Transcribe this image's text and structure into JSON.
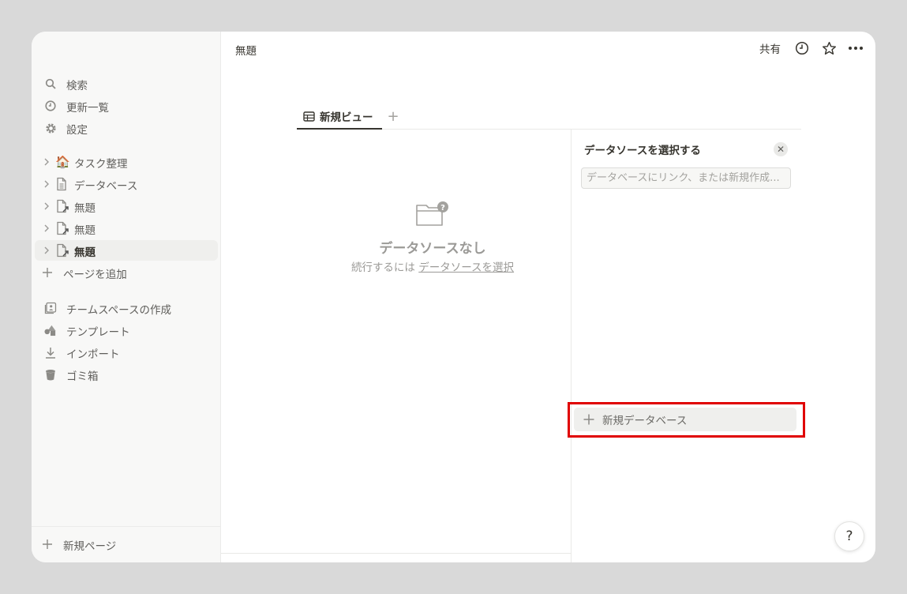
{
  "sidebar": {
    "top_items": [
      {
        "label": "検索",
        "icon": "search-icon"
      },
      {
        "label": "更新一覧",
        "icon": "clock-icon"
      },
      {
        "label": "設定",
        "icon": "gear-icon"
      }
    ],
    "pages": [
      {
        "label": "タスク整理",
        "icon": "house-emoji-icon",
        "emoji": "🏠"
      },
      {
        "label": "データベース",
        "icon": "page-icon"
      },
      {
        "label": "無題",
        "icon": "linked-page-icon"
      },
      {
        "label": "無題",
        "icon": "linked-page-icon"
      },
      {
        "label": "無題",
        "icon": "linked-page-icon",
        "active": true
      }
    ],
    "add_page_label": "ページを追加",
    "bottom_items": [
      {
        "label": "チームスペースの作成",
        "icon": "teamspace-icon"
      },
      {
        "label": "テンプレート",
        "icon": "shapes-icon"
      },
      {
        "label": "インポート",
        "icon": "download-icon"
      },
      {
        "label": "ゴミ箱",
        "icon": "trash-icon"
      }
    ],
    "new_page_label": "新規ページ"
  },
  "header": {
    "title": "無題",
    "share_label": "共有"
  },
  "view": {
    "tab_label": "新規ビュー",
    "add_view_glyph": "+"
  },
  "empty_state": {
    "title": "データソースなし",
    "subtitle_prefix": "続行するには",
    "subtitle_link": "データソースを選択"
  },
  "panel": {
    "title": "データソースを選択する",
    "close_glyph": "✕",
    "search_placeholder": "データベースにリンク、または新規作成...",
    "new_database_label": "新規データベース"
  },
  "help": {
    "label": "?"
  },
  "colors": {
    "highlight": "#e00000",
    "sidebar_bg": "#f8f8f7",
    "page_bg": "#d9d9d9"
  }
}
